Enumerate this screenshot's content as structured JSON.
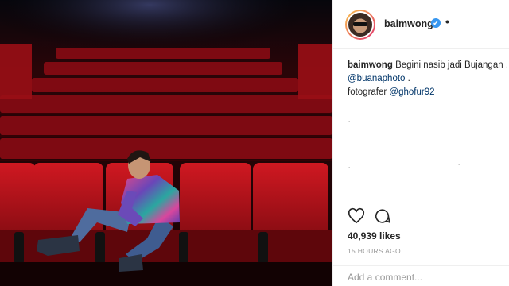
{
  "post": {
    "username": "baimwong",
    "verified_glyph": "✔",
    "separator": "•",
    "caption": {
      "user": "baimwong",
      "text": "Begini nasib jadi Bujangan .",
      "mention1": "@buanaphoto",
      "mention1_suffix": " .",
      "credit_prefix": "fotografer ",
      "mention2": "@ghofur92",
      "dots": [
        ".",
        ".",
        "."
      ]
    },
    "likes": "40,939 likes",
    "timestamp": "15 HOURS AGO",
    "comment_placeholder": "Add a comment..."
  },
  "icons": {
    "like": "heart-icon",
    "comment": "comment-bubble-icon",
    "verified": "verified-badge-icon",
    "avatar": "profile-avatar"
  },
  "colors": {
    "text": "#262626",
    "mention": "#003569",
    "muted": "#999999",
    "verified": "#3897f0",
    "seat_red": "#b0101a"
  }
}
